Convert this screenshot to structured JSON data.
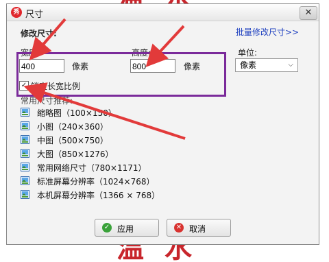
{
  "background": {
    "top_text": "温水",
    "bottom_text": "温水"
  },
  "window": {
    "title": "尺寸",
    "app_icon_text": "秀",
    "close": "✕"
  },
  "section": {
    "title": "修改尺寸:",
    "batch_link": "批量修改尺寸>>"
  },
  "width": {
    "label": "宽度:",
    "value": "400",
    "unit": "像素"
  },
  "height": {
    "label": "高度:",
    "value": "800",
    "unit": "像素"
  },
  "units": {
    "label": "单位:",
    "selected": "像素"
  },
  "lock_ratio": {
    "label": "锁定长宽比例",
    "checked": true
  },
  "common_sizes": {
    "label": "常用尺寸推荐:",
    "items": [
      "缩略图（100×150）",
      "小图（240×360）",
      "中图（500×750）",
      "大图（850×1276）",
      "常用网络尺寸（780×1171）",
      "标准屏幕分辨率（1024×768）",
      "本机屏幕分辨率（1366 × 768）"
    ]
  },
  "buttons": {
    "apply": "应用",
    "cancel": "取消"
  },
  "colors": {
    "arrow": "#e23a3a",
    "highlight": "#7a2a9a",
    "link": "#1d3fbf"
  }
}
